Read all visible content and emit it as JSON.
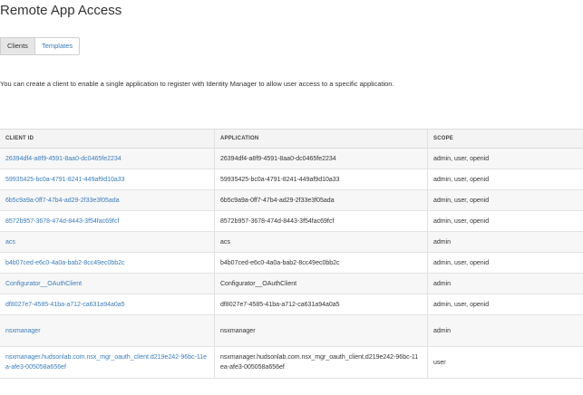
{
  "page": {
    "title": "Remote App Access"
  },
  "tabs": [
    {
      "label": "Clients",
      "active": true
    },
    {
      "label": "Templates",
      "active": false
    }
  ],
  "description": "You can create a client to enable a single application to register with Identity Manager to allow user access to a specific application.",
  "table": {
    "columns": [
      "CLIENT ID",
      "APPLICATION",
      "SCOPE"
    ],
    "rows": [
      {
        "client_id": "26394df4-a8f9-4591-8aa0-dc0465fe2234",
        "application": "26394df4-a8f9-4591-8aa0-dc0465fe2234",
        "scope": "admin, user, openid"
      },
      {
        "client_id": "59935425-bc0a-4791-8241-449af9d10a33",
        "application": "59935425-bc0a-4791-8241-449af9d10a33",
        "scope": "admin, user, openid"
      },
      {
        "client_id": "6b5c9a9a-0ff7-47b4-ad29-2f33e3f05ada",
        "application": "6b5c9a9a-0ff7-47b4-ad29-2f33e3f05ada",
        "scope": "admin, user, openid"
      },
      {
        "client_id": "8572b957-3678-474d-8443-3f54fac69fcf",
        "application": "8572b957-3678-474d-8443-3f54fac69fcf",
        "scope": "admin, user, openid"
      },
      {
        "client_id": "acs",
        "application": "acs",
        "scope": "admin"
      },
      {
        "client_id": "b4b07ced-e6c0-4a0a-bab2-8cc49ec0bb2c",
        "application": "b4b07ced-e6c0-4a0a-bab2-8cc49ec0bb2c",
        "scope": "admin, user, openid"
      },
      {
        "client_id": "Configurator__OAuthClient",
        "application": "Configurator__OAuthClient",
        "scope": "admin"
      },
      {
        "client_id": "df8027e7-4585-41ba-a712-ca631a94a0a5",
        "application": "df8027e7-4585-41ba-a712-ca631a94a0a5",
        "scope": "admin, user, openid"
      },
      {
        "client_id": "nsxmanager",
        "application": "nsxmanager",
        "scope": "admin"
      },
      {
        "client_id": "nsxmanager.hudsonlab.com.nsx_mgr_oauth_client.d219e242-96bc-11ea-afe3-005058a656ef",
        "application": "nsxmanager.hudsonlab.com.nsx_mgr_oauth_client.d219e242-96bc-11ea-afe3-005058a656ef",
        "scope": "user"
      }
    ]
  }
}
